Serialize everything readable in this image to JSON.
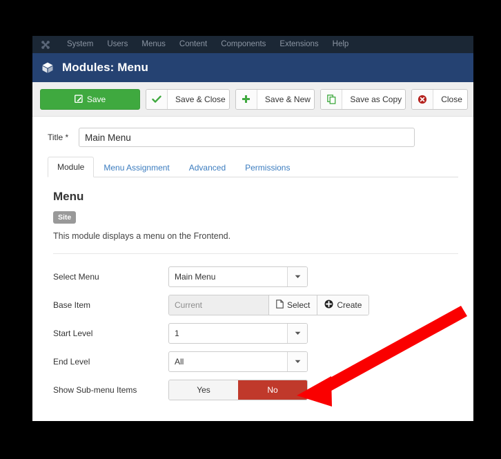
{
  "admin_nav": {
    "brand_icon": "joomla-logo-icon",
    "items": [
      {
        "label": "System"
      },
      {
        "label": "Users"
      },
      {
        "label": "Menus"
      },
      {
        "label": "Content"
      },
      {
        "label": "Components"
      },
      {
        "label": "Extensions"
      },
      {
        "label": "Help"
      }
    ]
  },
  "header": {
    "icon": "module-cube-icon",
    "title": "Modules: Menu"
  },
  "toolbar": {
    "buttons": [
      {
        "label": "Save",
        "icon": "edit-pencil-icon",
        "style": "primary"
      },
      {
        "label": "Save & Close",
        "icon": "check-icon",
        "style": "default"
      },
      {
        "label": "Save & New",
        "icon": "plus-icon",
        "style": "default"
      },
      {
        "label": "Save as Copy",
        "icon": "copy-icon",
        "style": "default"
      },
      {
        "label": "Close",
        "icon": "close-circle-icon",
        "style": "default"
      }
    ]
  },
  "title_field": {
    "label": "Title *",
    "value": "Main Menu",
    "placeholder": ""
  },
  "tabs": [
    {
      "label": "Module",
      "active": true
    },
    {
      "label": "Menu Assignment",
      "active": false
    },
    {
      "label": "Advanced",
      "active": false
    },
    {
      "label": "Permissions",
      "active": false
    }
  ],
  "module_info": {
    "heading": "Menu",
    "badge": "Site",
    "description": "This module displays a menu on the Frontend."
  },
  "fields": {
    "select_menu": {
      "label": "Select Menu",
      "value": "Main Menu",
      "caret_icon": "chevron-down-icon"
    },
    "base_item": {
      "label": "Base Item",
      "value": "Current",
      "select_button": "Select",
      "select_icon": "file-icon",
      "create_button": "Create",
      "create_icon": "plus-circle-icon"
    },
    "start_level": {
      "label": "Start Level",
      "value": "1",
      "caret_icon": "chevron-down-icon"
    },
    "end_level": {
      "label": "End Level",
      "value": "All",
      "caret_icon": "chevron-down-icon"
    },
    "show_submenu_items": {
      "label": "Show Sub-menu Items",
      "yes_label": "Yes",
      "no_label": "No",
      "selected": "No"
    }
  },
  "annotation": {
    "type": "arrow",
    "color": "#fa0000",
    "points_to": "show-submenu-items-toggle"
  },
  "colors": {
    "nav_background": "#1b2735",
    "header_background": "#254272",
    "toolbar_background": "#efefef",
    "primary_button": "#3fa93f",
    "danger_active": "#c0392b",
    "badge_grey": "#999999",
    "link_blue": "#3b7cbf",
    "page_background": "#000000"
  }
}
